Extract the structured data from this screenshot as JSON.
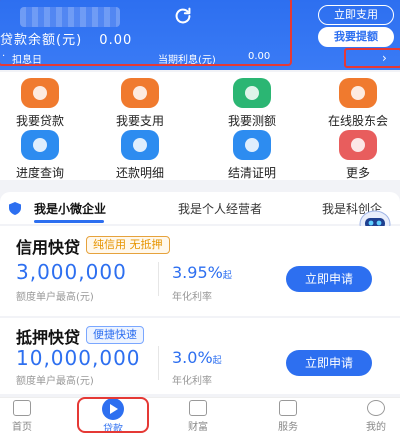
{
  "header": {
    "balance_label": "贷款余额(元)",
    "balance_value": "0.00",
    "deduct_label": "扣息日",
    "interest_label": "当期利息(元)",
    "interest_value": "0.00",
    "use_now": "立即支用",
    "withdraw": "我要提额",
    "refresh_icon": "refresh-icon",
    "more_icon": "chevron-right-icon"
  },
  "quick_actions": [
    {
      "label": "我要贷款",
      "icon": "money-bag-icon",
      "color": "#f07a2e"
    },
    {
      "label": "我要支用",
      "icon": "card-icon",
      "color": "#f07a2e"
    },
    {
      "label": "我要测额",
      "icon": "gauge-icon",
      "color": "#2bb673"
    },
    {
      "label": "在线股东会",
      "icon": "meeting-icon",
      "color": "#f07a2e"
    },
    {
      "label": "进度查询",
      "icon": "progress-icon",
      "color": "#2d8cf0"
    },
    {
      "label": "还款明细",
      "icon": "repay-icon",
      "color": "#2d8cf0"
    },
    {
      "label": "结清证明",
      "icon": "certificate-icon",
      "color": "#2d8cf0"
    },
    {
      "label": "更多",
      "icon": "more-icon",
      "color": "#e85d5d"
    }
  ],
  "tabs": [
    {
      "label": "我是小微企业"
    },
    {
      "label": "我是个人经营者"
    },
    {
      "label": "我是科创企"
    }
  ],
  "products": [
    {
      "title": "信用快贷",
      "tag": "纯信用 无抵押",
      "amount": "3,000,000",
      "amount_sub": "额度单户最高(元)",
      "rate": "3.95%",
      "rate_suffix": "起",
      "rate_sub": "年化利率",
      "apply": "立即申请"
    },
    {
      "title": "抵押快贷",
      "tag": "便捷快速",
      "amount": "10,000,000",
      "amount_sub": "额度单户最高(元)",
      "rate": "3.0%",
      "rate_suffix": "起",
      "rate_sub": "年化利率",
      "apply": "立即申请"
    }
  ],
  "nav": [
    {
      "label": "首页"
    },
    {
      "label": "贷款"
    },
    {
      "label": "财富"
    },
    {
      "label": "服务"
    },
    {
      "label": "我的"
    }
  ],
  "colors": {
    "primary": "#2d6ff0",
    "highlight": "#e53935"
  }
}
